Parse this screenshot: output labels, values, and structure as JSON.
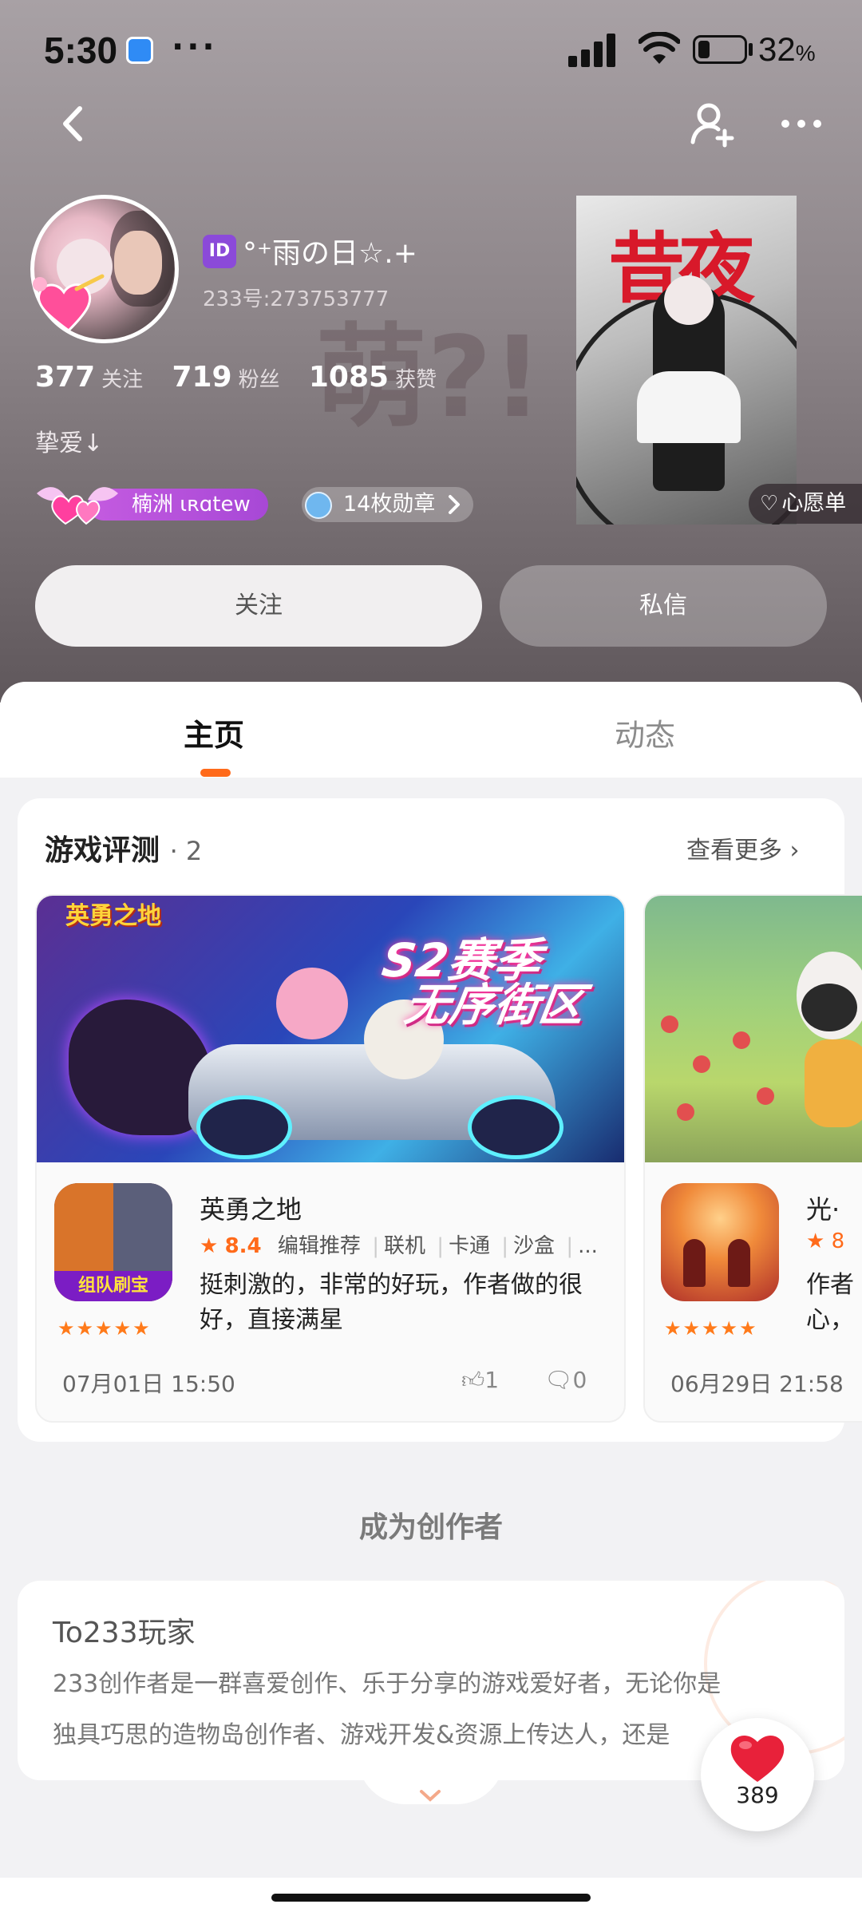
{
  "status_bar": {
    "time": "5:30",
    "dots": "···",
    "battery": "32",
    "battery_unit": "%"
  },
  "profile": {
    "nickname": "°⁺雨の日☆.+",
    "id_badge": "ID",
    "user_id": "233号:273753777",
    "stats": [
      {
        "value": "377",
        "label": "关注"
      },
      {
        "value": "719",
        "label": "粉丝"
      },
      {
        "value": "1085",
        "label": "获赞"
      }
    ],
    "bio": "挚爱↓",
    "watermark": "萌?!",
    "tag_label": "楠洲 ɩʀɑtew",
    "badges_label": "14枚勋章",
    "cover_title": "昔夜",
    "wishlist_label": "心愿单",
    "follow_button": "关注",
    "message_button": "私信"
  },
  "tabs": {
    "home": "主页",
    "feed": "动态"
  },
  "reviews": {
    "title": "游戏评测",
    "count": "· 2",
    "more": "查看更多",
    "items": [
      {
        "banner_logo": "英勇之地",
        "banner_line1": "S2赛季",
        "banner_line2": "无序街区",
        "icon_caption": "组队刷宝",
        "name": "英勇之地",
        "score": "8.4",
        "tags": [
          "编辑推荐",
          "联机",
          "卡通",
          "沙盒",
          "..."
        ],
        "text": "挺刺激的，非常的好玩，作者做的很好，直接满星",
        "stars": "★★★★★",
        "date": "07月01日 15:50",
        "likes": "1",
        "comments": "0"
      },
      {
        "name": "光·",
        "score": "8",
        "text": "作者心，",
        "stars": "★★★★★",
        "date": "06月29日 21:58"
      }
    ]
  },
  "creator": {
    "heading": "成为创作者",
    "card_title": "To233玩家",
    "line1": "233创作者是一群喜爱创作、乐于分享的游戏爱好者，无论你是",
    "line2": "独具巧思的造物岛创作者、游戏开发&资源上传达人，还是"
  },
  "fab": {
    "like_count": "389"
  },
  "colors": {
    "accent": "#ff6a1a",
    "tag_purple": "#b04ed9",
    "heart_red": "#e8213a"
  }
}
